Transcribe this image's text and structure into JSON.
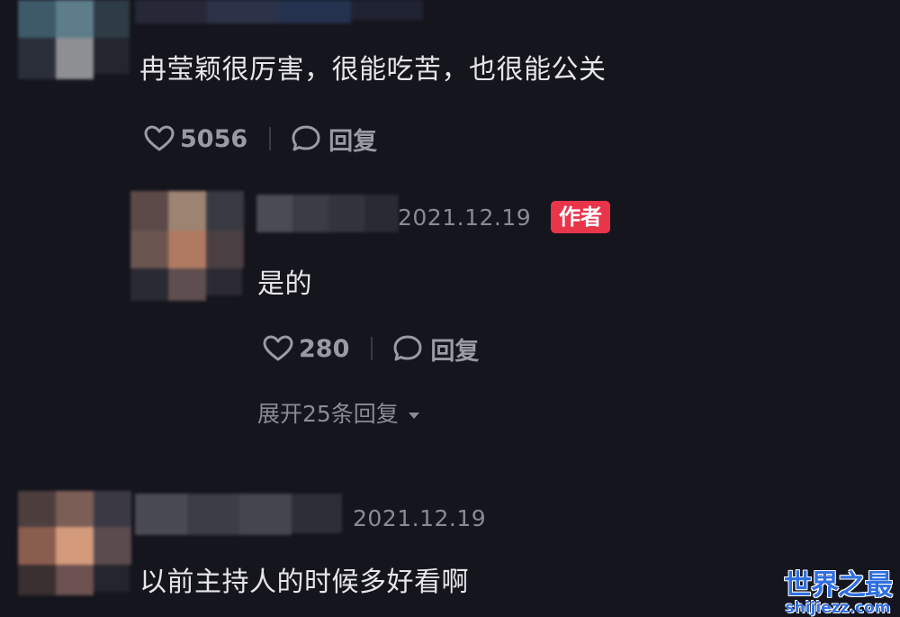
{
  "comments": [
    {
      "text": "冉莹颖很厉害，很能吃苦，也很能公关",
      "likes": "5056",
      "reply_label": "回复"
    },
    {
      "date": "2021.12.19",
      "badge": "作者",
      "text": "是的",
      "likes": "280",
      "reply_label": "回复",
      "expand_label": "展开25条回复"
    },
    {
      "date": "2021.12.19",
      "text": "以前主持人的时候多好看啊"
    }
  ],
  "watermark": {
    "main": "世界之最",
    "sub": "shijiezz.com"
  },
  "icons": {
    "like": "heart-outline-icon",
    "reply": "speech-bubble-icon",
    "expand": "caret-down-icon"
  },
  "colors": {
    "background": "#15151d",
    "badge": "#e8354a",
    "watermark": "#2f6fe0"
  }
}
